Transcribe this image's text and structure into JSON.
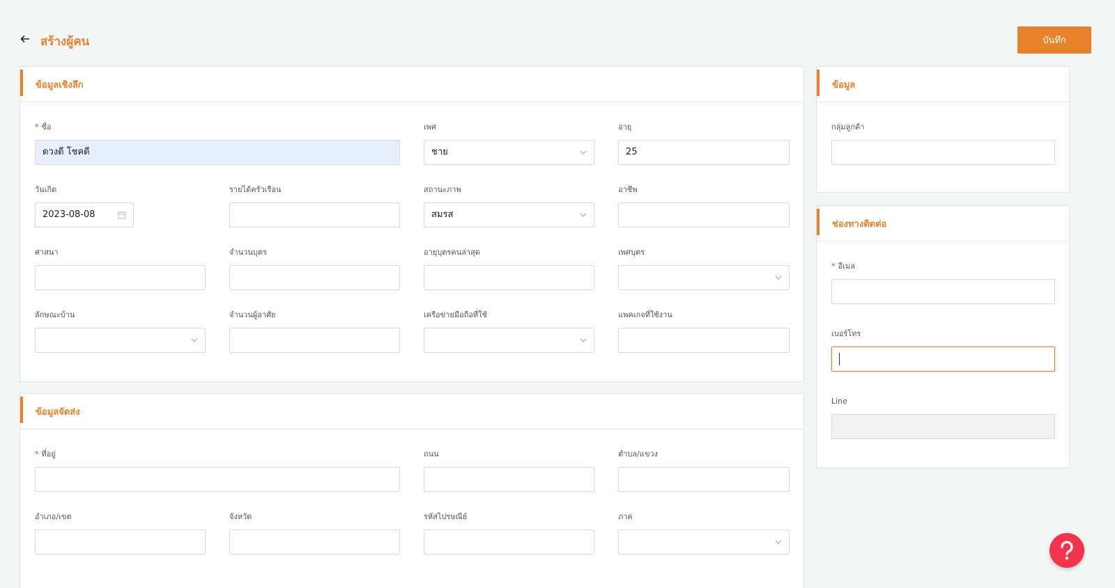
{
  "header": {
    "title": "สร้างผู้คน",
    "save_label": "บันทึก"
  },
  "colors": {
    "accent": "#e8822a",
    "help": "#f0354c"
  },
  "personal": {
    "title": "ข้อมูลเชิงลึก",
    "name": {
      "label": "ชื่อ",
      "value": "ดวงดี โชคดี"
    },
    "gender": {
      "label": "เพศ",
      "value": "ชาย"
    },
    "age": {
      "label": "อายุ",
      "value": "25"
    },
    "birthday": {
      "label": "วันเกิด",
      "value": "2023-08-08"
    },
    "income": {
      "label": "รายได้ครัวเรือน",
      "value": ""
    },
    "marital": {
      "label": "สถานะภาพ",
      "value": "สมรส"
    },
    "occupation": {
      "label": "อาชีพ",
      "value": ""
    },
    "religion": {
      "label": "ศาสนา",
      "value": ""
    },
    "children": {
      "label": "จำนวนบุตร",
      "value": ""
    },
    "youngest_age": {
      "label": "อายุบุตรคนล่าสุด",
      "value": ""
    },
    "child_gender": {
      "label": "เพศบุตร",
      "value": ""
    },
    "house_type": {
      "label": "ลักษณะบ้าน",
      "value": ""
    },
    "residents": {
      "label": "จำนวนผู้อาศัย",
      "value": ""
    },
    "network": {
      "label": "เครือข่ายมือถือที่ใช้",
      "value": ""
    },
    "package": {
      "label": "แพคเกจที่ใช้งาน",
      "value": ""
    }
  },
  "delivery": {
    "title": "ข้อมูลจัดส่ง",
    "address": {
      "label": "ที่อยู่",
      "value": ""
    },
    "road": {
      "label": "ถนน",
      "value": ""
    },
    "subdistrict": {
      "label": "ตำบล/แขวง",
      "value": ""
    },
    "district": {
      "label": "อำเภอ/เขต",
      "value": ""
    },
    "province": {
      "label": "จังหวัด",
      "value": ""
    },
    "postcode": {
      "label": "รหัสไปรษณีย์",
      "value": ""
    },
    "region": {
      "label": "ภาค",
      "value": ""
    }
  },
  "info": {
    "title": "ข้อมูล",
    "customer_group": {
      "label": "กลุ่มลูกค้า",
      "value": ""
    }
  },
  "contact": {
    "title": "ช่องทางติดต่อ",
    "email": {
      "label": "อีเมล",
      "value": ""
    },
    "phone": {
      "label": "เบอร์โทร",
      "value": ""
    },
    "line": {
      "label": "Line",
      "value": ""
    }
  }
}
